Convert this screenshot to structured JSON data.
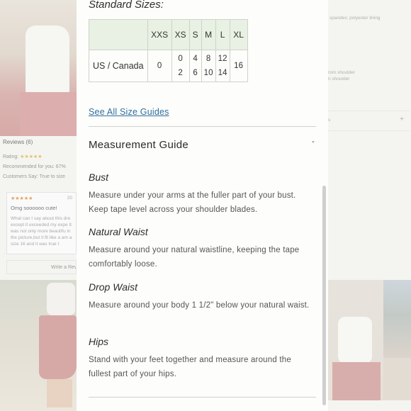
{
  "background": {
    "reviews": {
      "title": "Reviews (6)",
      "rating_label": "Rating:",
      "rating_stars": "★★★★★",
      "recommended": "Recommended for you: 67%",
      "customers_say": "Customers Say: True to size"
    },
    "review_card": {
      "stars": "★★★★★",
      "date": "20",
      "title": "Omg soooooo cute!",
      "body": "What can I say about this dre except it exceeded my expe It was not only more beautifu in the picture,but it fit like a am a size 16 and it was true t"
    },
    "write_review": "Write a Rev",
    "right": {
      "material": "spandex; polyester lining",
      "shoulder_line1": "rom shoulder",
      "shoulder_line2": "n shoulder",
      "accordion_label": "s",
      "accordion_plus": "+"
    }
  },
  "size_guide": {
    "standard_sizes_title": "Standard Sizes:",
    "table": {
      "headers": [
        "XXS",
        "XS",
        "S",
        "M",
        "L",
        "XL"
      ],
      "rows": [
        {
          "region": "US / Canada",
          "cells": [
            "0",
            "0 2",
            "4 6",
            "8 10",
            "12 14",
            "16"
          ]
        }
      ]
    },
    "see_all_link": "See All Size Guides",
    "measurement_guide_title": "Measurement Guide",
    "collapse_symbol": "-",
    "measurements": [
      {
        "name": "Bust",
        "text": "Measure under your arms at the fuller part of your bust. Keep tape level across your shoulder blades."
      },
      {
        "name": "Natural Waist",
        "text": "Measure around your natural waistline, keeping the tape comfortably loose."
      },
      {
        "name": "Drop Waist",
        "text": "Measure around your body 1 1/2\" below your natural waist."
      },
      {
        "name": "Hips",
        "text": "Stand with your feet together and measure around the fullest part of your hips."
      }
    ]
  }
}
